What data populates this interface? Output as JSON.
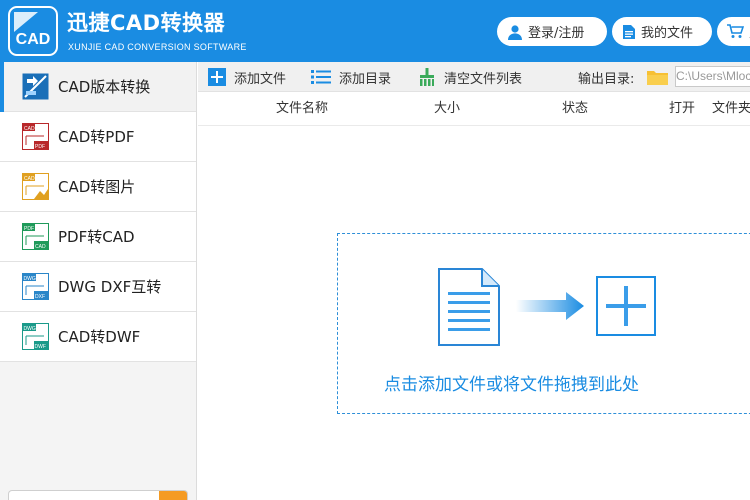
{
  "app": {
    "title": "迅捷CAD转换器",
    "subtitle": "XUNJIE CAD CONVERSION SOFTWARE",
    "logo_text": "CAD",
    "accent_color": "#1a8ce2"
  },
  "header_buttons": {
    "login": {
      "label": "登录/注册",
      "icon": "user-icon"
    },
    "my_files": {
      "label": "我的文件",
      "icon": "document-icon"
    },
    "cart": {
      "label": "购",
      "icon": "cart-icon"
    }
  },
  "sidebar": {
    "items": [
      {
        "label": "CAD版本转换",
        "icon": "cad-version-convert-icon",
        "active": true
      },
      {
        "label": "CAD转PDF",
        "icon": "cad-to-pdf-icon",
        "active": false
      },
      {
        "label": "CAD转图片",
        "icon": "cad-to-image-icon",
        "active": false
      },
      {
        "label": "PDF转CAD",
        "icon": "pdf-to-cad-icon",
        "active": false
      },
      {
        "label": "DWG DXF互转",
        "icon": "dwg-dxf-convert-icon",
        "active": false
      },
      {
        "label": "CAD转DWF",
        "icon": "cad-to-dwf-icon",
        "active": false
      }
    ]
  },
  "toolbar": {
    "add_file": "添加文件",
    "add_dir": "添加目录",
    "clear_list": "清空文件列表",
    "output_label": "输出目录:",
    "output_path": "C:\\Users\\Mloc"
  },
  "table": {
    "columns": [
      "文件名称",
      "大小",
      "状态",
      "打开",
      "文件夹"
    ]
  },
  "dropzone": {
    "text": "点击添加文件或将文件拖拽到此处"
  }
}
